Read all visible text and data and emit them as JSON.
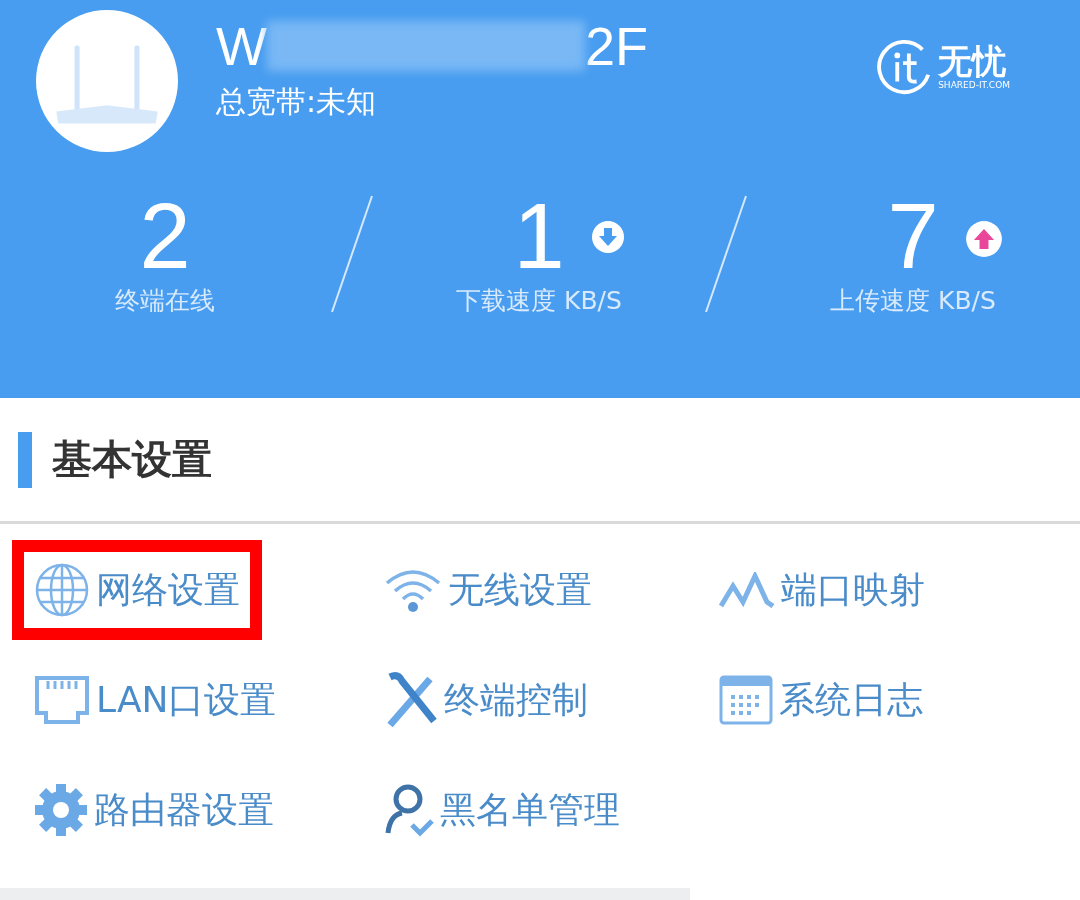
{
  "header": {
    "device_name_start": "W",
    "device_name_end": "2F",
    "bandwidth": "总宽带:未知",
    "logo": {
      "text": "无忧",
      "subtext": "SHARED-IT.COM"
    }
  },
  "stats": [
    {
      "value": "2",
      "label": "终端在线"
    },
    {
      "value": "1",
      "label": "下载速度 KB/S",
      "kind": "download"
    },
    {
      "value": "7",
      "label": "上传速度 KB/S",
      "kind": "upload"
    }
  ],
  "section": {
    "title": "基本设置"
  },
  "menu_items": [
    {
      "label": "网络设置",
      "highlighted": true
    },
    {
      "label": "无线设置",
      "highlighted": false
    },
    {
      "label": "端口映射",
      "highlighted": false
    },
    {
      "label": "LAN口设置",
      "highlighted": false
    },
    {
      "label": "终端控制",
      "highlighted": false
    },
    {
      "label": "系统日志",
      "highlighted": false
    },
    {
      "label": "路由器设置",
      "highlighted": false
    },
    {
      "label": "黑名单管理",
      "highlighted": false
    }
  ]
}
